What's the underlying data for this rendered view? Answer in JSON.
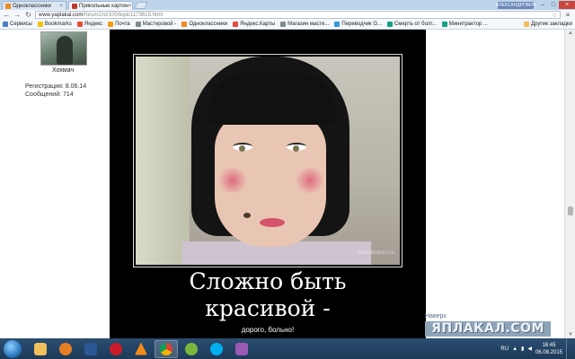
{
  "browser": {
    "tabs": [
      {
        "title": "Одноклассники",
        "icon": "odnoklassniki-icon",
        "color": "#ef8a1c",
        "active": false
      },
      {
        "title": "Прикольные картин",
        "icon": "yaplakal-icon",
        "color": "#c0392b",
        "active": true
      }
    ],
    "profile_badge": "АЛЕКСАНДРОВИЧ",
    "url_host": "www.yaplakal.com",
    "url_path": "/forum2/st/100/topic1173615.html",
    "bookmarks": [
      {
        "label": "Сервисы",
        "icon": "apps-icon",
        "color": "#4a7fc0"
      },
      {
        "label": "Bookmarks",
        "icon": "star-icon",
        "color": "#f1c40f"
      },
      {
        "label": "Яндекс",
        "icon": "yandex-icon",
        "color": "#e74c3c"
      },
      {
        "label": "Почта",
        "icon": "mail-icon",
        "color": "#f39c12"
      },
      {
        "label": "Мастеровой -",
        "icon": "page-icon",
        "color": "#7f8c8d"
      },
      {
        "label": "Одноклассники",
        "icon": "odnoklassniki-icon",
        "color": "#ef8a1c"
      },
      {
        "label": "Яндекс.Карты",
        "icon": "maps-icon",
        "color": "#e74c3c"
      },
      {
        "label": "Магазин масте...",
        "icon": "page-icon",
        "color": "#7f8c8d"
      },
      {
        "label": "Переводчик G...",
        "icon": "translate-icon",
        "color": "#3498db"
      },
      {
        "label": "Смерть от болг...",
        "icon": "page-icon",
        "color": "#16a085"
      },
      {
        "label": "Минитрактор ...",
        "icon": "page-icon",
        "color": "#16a085"
      }
    ],
    "other_bookmarks": "Другие закладки"
  },
  "forum": {
    "username": "Хохмач",
    "registration": "Регистрация: 8.06.14",
    "posts": "Сообщений: 714",
    "demotivator": {
      "caption_line1": "Сложно быть",
      "caption_line2": "красивой -",
      "subcaption": "дорого, больно!",
      "watermark": "demotivators.ru"
    },
    "to_top": "Наверх",
    "site_logo": "ЯПЛАКАЛ.COM"
  },
  "taskbar": {
    "apps": [
      {
        "name": "explorer",
        "icon": "folder-icon",
        "color": "#f0c05a",
        "active": false
      },
      {
        "name": "media-player",
        "icon": "play-icon",
        "color": "#e67e22",
        "active": false
      },
      {
        "name": "word",
        "icon": "word-icon",
        "color": "#2b5797",
        "active": false
      },
      {
        "name": "opera",
        "icon": "opera-icon",
        "color": "#cc1b2a",
        "active": false
      },
      {
        "name": "vlc",
        "icon": "vlc-icon",
        "color": "#f28c1b",
        "active": false
      },
      {
        "name": "chrome",
        "icon": "chrome-icon",
        "color": "#4caf50",
        "active": true
      },
      {
        "name": "utorrent",
        "icon": "utorrent-icon",
        "color": "#78b83c",
        "active": false
      },
      {
        "name": "skype",
        "icon": "skype-icon",
        "color": "#00aff0",
        "active": false
      },
      {
        "name": "paint",
        "icon": "paint-icon",
        "color": "#9b59b6",
        "active": false
      }
    ],
    "language": "RU",
    "time": "16:45",
    "date": "06.08.2015"
  }
}
